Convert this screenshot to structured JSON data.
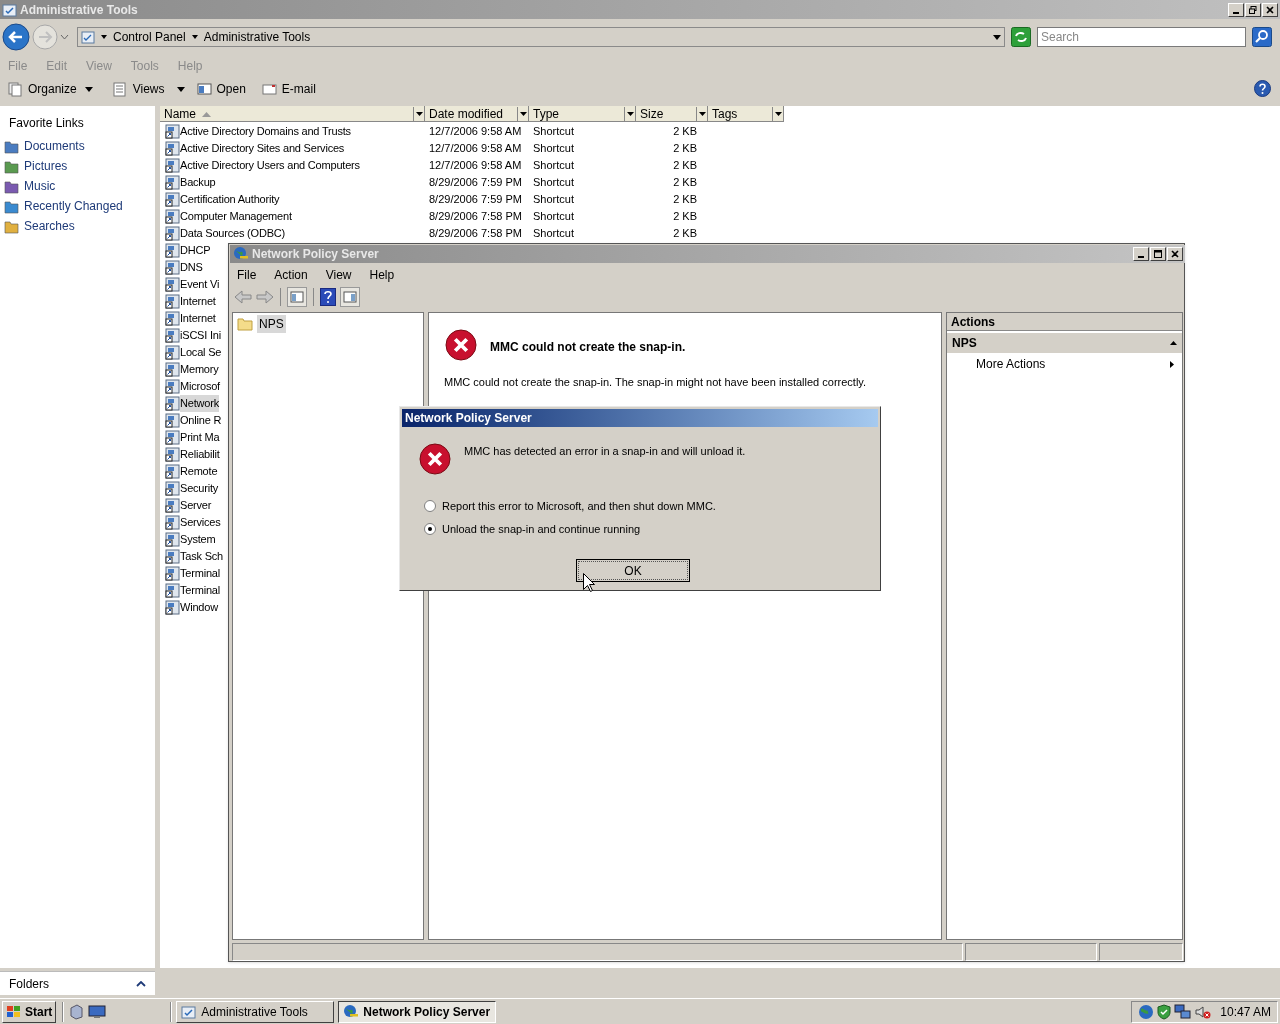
{
  "explorer": {
    "title": "Administrative Tools",
    "breadcrumb": [
      "Control Panel",
      "Administrative Tools"
    ],
    "search": {
      "placeholder": "Search"
    },
    "menu": [
      "File",
      "Edit",
      "View",
      "Tools",
      "Help"
    ],
    "toolbar": [
      "Organize",
      "Views",
      "Open",
      "E-mail"
    ],
    "favorite_links": {
      "heading": "Favorite Links",
      "items": [
        "Documents",
        "Pictures",
        "Music",
        "Recently Changed",
        "Searches"
      ]
    },
    "folders": "Folders",
    "columns": [
      "Name",
      "Date modified",
      "Type",
      "Size",
      "Tags"
    ],
    "rows": [
      {
        "name": "Active Directory Domains and Trusts",
        "date": "12/7/2006 9:58 AM",
        "type": "Shortcut",
        "size": "2 KB",
        "selected": false
      },
      {
        "name": "Active Directory Sites and Services",
        "date": "12/7/2006 9:58 AM",
        "type": "Shortcut",
        "size": "2 KB",
        "selected": false
      },
      {
        "name": "Active Directory Users and Computers",
        "date": "12/7/2006 9:58 AM",
        "type": "Shortcut",
        "size": "2 KB",
        "selected": false
      },
      {
        "name": "Backup",
        "date": "8/29/2006 7:59 PM",
        "type": "Shortcut",
        "size": "2 KB",
        "selected": false
      },
      {
        "name": "Certification Authority",
        "date": "8/29/2006 7:59 PM",
        "type": "Shortcut",
        "size": "2 KB",
        "selected": false
      },
      {
        "name": "Computer Management",
        "date": "8/29/2006 7:58 PM",
        "type": "Shortcut",
        "size": "2 KB",
        "selected": false
      },
      {
        "name": "Data Sources (ODBC)",
        "date": "8/29/2006 7:58 PM",
        "type": "Shortcut",
        "size": "2 KB",
        "selected": false
      },
      {
        "name": "DHCP",
        "selected": false
      },
      {
        "name": "DNS",
        "selected": false
      },
      {
        "name": "Event Vi",
        "selected": false
      },
      {
        "name": "Internet",
        "selected": false
      },
      {
        "name": "Internet",
        "selected": false
      },
      {
        "name": "iSCSI Ini",
        "selected": false
      },
      {
        "name": "Local Se",
        "selected": false
      },
      {
        "name": "Memory",
        "selected": false
      },
      {
        "name": "Microsof",
        "selected": false
      },
      {
        "name": "Network",
        "selected": true
      },
      {
        "name": "Online R",
        "selected": false
      },
      {
        "name": "Print Ma",
        "selected": false
      },
      {
        "name": "Reliabilit",
        "selected": false
      },
      {
        "name": "Remote",
        "selected": false
      },
      {
        "name": "Security",
        "selected": false
      },
      {
        "name": "Server",
        "selected": false
      },
      {
        "name": "Services",
        "selected": false
      },
      {
        "name": "System",
        "selected": false
      },
      {
        "name": "Task Sch",
        "selected": false
      },
      {
        "name": "Terminal",
        "selected": false
      },
      {
        "name": "Terminal",
        "selected": false
      },
      {
        "name": "Window",
        "selected": false
      }
    ]
  },
  "mmc": {
    "title": "Network Policy Server",
    "menu": [
      "File",
      "Action",
      "View",
      "Help"
    ],
    "tree": [
      {
        "label": "NPS",
        "selected": true
      }
    ],
    "error_title": "MMC could not create the snap-in.",
    "error_text": "MMC could not create the snap-in. The snap-in might not have been installed correctly.",
    "actions": {
      "heading": "Actions",
      "group": "NPS",
      "items": [
        "More Actions"
      ]
    }
  },
  "dialog": {
    "title": "Network Policy Server",
    "message": "MMC has detected an error in a snap-in and will unload it.",
    "options": [
      {
        "label": "Report this error to Microsoft, and then shut down MMC.",
        "selected": false
      },
      {
        "label": "Unload the snap-in and continue running",
        "selected": true
      }
    ],
    "button": "OK"
  },
  "taskbar": {
    "start": "Start",
    "tasks": [
      {
        "label": "Administrative Tools",
        "selected": false
      },
      {
        "label": "Network Policy Server",
        "selected": true
      }
    ],
    "clock": "10:47 AM"
  }
}
